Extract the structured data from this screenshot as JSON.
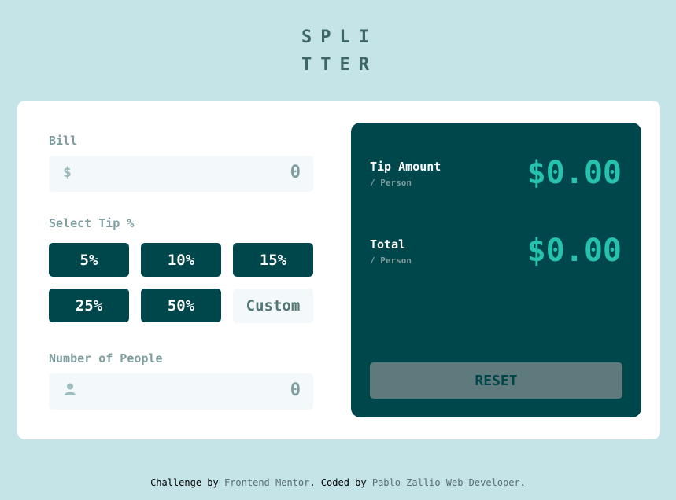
{
  "logo": {
    "line1": "SPLI",
    "line2": "TTER"
  },
  "bill": {
    "label": "Bill",
    "currency_symbol": "$",
    "value": "0"
  },
  "tip": {
    "label": "Select Tip %",
    "options": [
      "5%",
      "10%",
      "15%",
      "25%",
      "50%"
    ],
    "custom_placeholder": "Custom"
  },
  "people": {
    "label": "Number of People",
    "value": "0"
  },
  "results": {
    "tip_amount": {
      "title": "Tip Amount",
      "sub": "/ Person",
      "value": "$0.00"
    },
    "total": {
      "title": "Total",
      "sub": "/ Person",
      "value": "$0.00"
    },
    "reset_label": "RESET"
  },
  "footer": {
    "prefix": "Challenge by ",
    "link1": "Frontend Mentor",
    "middle": ". Coded by ",
    "link2": "Pablo Zallio Web Developer",
    "suffix": "."
  },
  "colors": {
    "background": "#c5e4e7",
    "dark_cyan": "#00474b",
    "accent": "#26c2ae",
    "input_bg": "#f3f9fa"
  },
  "icons": {
    "currency": "dollar-icon",
    "people": "person-icon"
  }
}
